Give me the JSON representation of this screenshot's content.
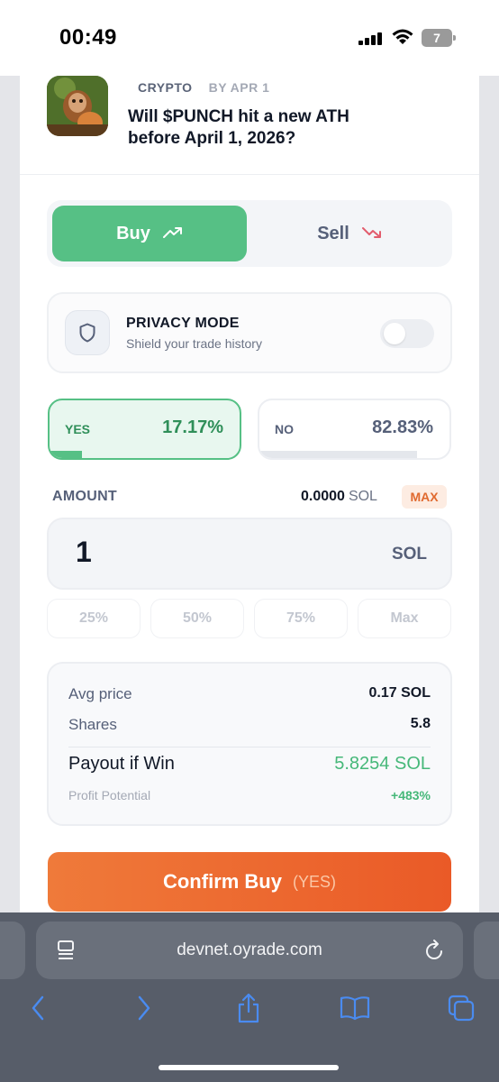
{
  "status_bar": {
    "time": "00:49",
    "battery": "7"
  },
  "market": {
    "category": "CRYPTO",
    "deadline": "BY APR 1",
    "title": "Will $PUNCH hit a new ATH before April 1, 2026?"
  },
  "trade_toggle": {
    "buy_label": "Buy",
    "sell_label": "Sell",
    "selected": "Buy"
  },
  "privacy": {
    "title": "PRIVACY MODE",
    "subtitle": "Shield your trade history",
    "enabled": false
  },
  "outcomes": {
    "yes": {
      "label": "YES",
      "percent": "17.17%",
      "value": 17.17
    },
    "no": {
      "label": "NO",
      "percent": "82.83%",
      "value": 82.83
    }
  },
  "amount": {
    "label": "AMOUNT",
    "balance": "0.0000",
    "balance_unit": "SOL",
    "max_label": "MAX",
    "value": "1",
    "unit": "SOL",
    "quick_picks": [
      "25%",
      "50%",
      "75%",
      "Max"
    ]
  },
  "summary": {
    "avg_price_label": "Avg price",
    "avg_price_value": "0.17 SOL",
    "shares_label": "Shares",
    "shares_value": "5.8",
    "payout_label": "Payout if Win",
    "payout_value": "5.8254 SOL",
    "profit_label": "Profit Potential",
    "profit_value": "+483%"
  },
  "confirm": {
    "label": "Confirm Buy",
    "sub": "(YES)"
  },
  "browser": {
    "url": "devnet.oyrade.com"
  },
  "colors": {
    "green": "#56c085",
    "orange": "#ea5a27",
    "muted": "#566079"
  }
}
